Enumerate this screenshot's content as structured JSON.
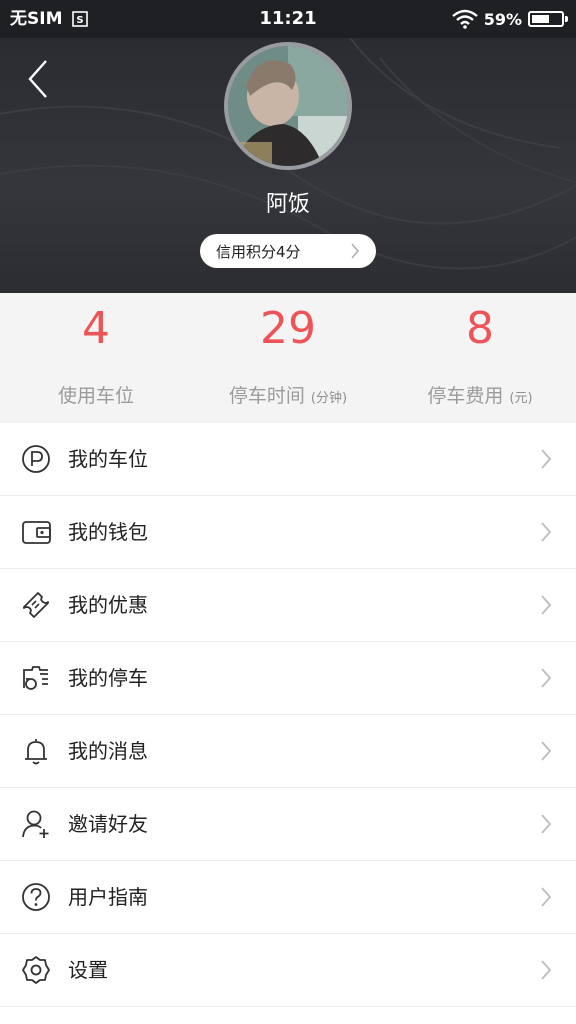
{
  "status_bar": {
    "carrier": "无SIM",
    "sim_icon": "sim-card-icon",
    "time": "11:21",
    "battery": "59%",
    "battery_level": 0.59
  },
  "profile": {
    "username": "阿饭",
    "credit_label": "信用积分4分"
  },
  "stats": [
    {
      "value": "4",
      "label": "使用车位",
      "unit": ""
    },
    {
      "value": "29",
      "label": "停车时间",
      "unit": "(分钟)"
    },
    {
      "value": "8",
      "label": "停车费用",
      "unit": "(元)"
    }
  ],
  "menu": {
    "items": [
      {
        "label": "我的车位",
        "icon": "parking-icon"
      },
      {
        "label": "我的钱包",
        "icon": "wallet-icon"
      },
      {
        "label": "我的优惠",
        "icon": "coupon-icon"
      },
      {
        "label": "我的停车",
        "icon": "parking-record-icon"
      },
      {
        "label": "我的消息",
        "icon": "bell-icon"
      },
      {
        "label": "邀请好友",
        "icon": "add-friend-icon"
      },
      {
        "label": "用户指南",
        "icon": "help-icon"
      },
      {
        "label": "设置",
        "icon": "settings-icon"
      }
    ]
  },
  "colors": {
    "accent": "#ee5457",
    "header_bg": "#2e3035",
    "stats_bg": "#f4f4f4"
  }
}
